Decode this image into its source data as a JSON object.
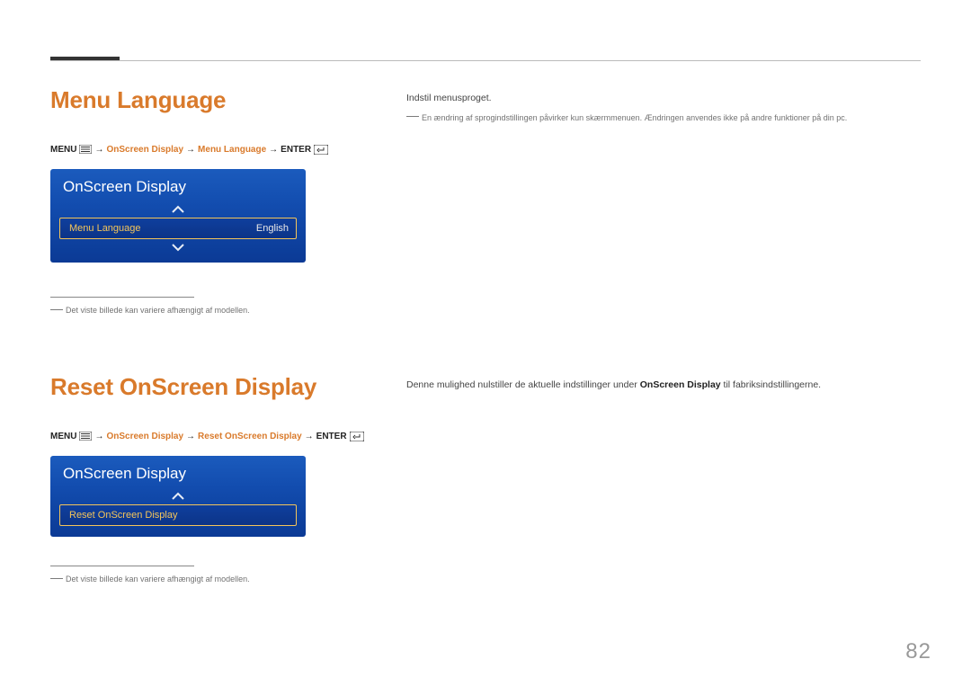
{
  "page_number": "82",
  "section1": {
    "heading": "Menu Language",
    "breadcrumb": {
      "menu": "MENU",
      "arrow": "→",
      "p1": "OnScreen Display",
      "p2": "Menu Language",
      "enter": "ENTER"
    },
    "osd": {
      "title": "OnScreen Display",
      "row_label": "Menu Language",
      "row_value": "English"
    },
    "footnote": "Det viste billede kan variere afhængigt af modellen.",
    "right": {
      "line1": "Indstil menusproget.",
      "note": "En ændring af sprogindstillingen påvirker kun skærmmenuen. Ændringen anvendes ikke på andre funktioner på din pc."
    }
  },
  "section2": {
    "heading": "Reset OnScreen Display",
    "breadcrumb": {
      "menu": "MENU",
      "arrow": "→",
      "p1": "OnScreen Display",
      "p2": "Reset OnScreen Display",
      "enter": "ENTER"
    },
    "osd": {
      "title": "OnScreen Display",
      "row_label": "Reset OnScreen Display"
    },
    "footnote": "Det viste billede kan variere afhængigt af modellen.",
    "right": {
      "line_pre": "Denne mulighed nulstiller de aktuelle indstillinger under ",
      "bold": "OnScreen Display",
      "line_post": " til fabriksindstillingerne."
    }
  }
}
